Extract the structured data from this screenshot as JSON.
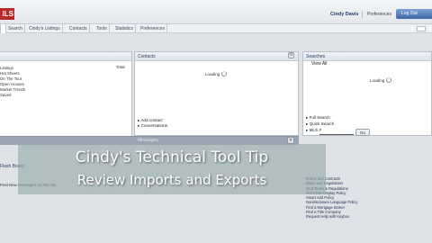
{
  "header": {
    "logo_text": "ILS",
    "user_name": "Cindy Davis",
    "preferences_link": "Preferences",
    "logout_label": "Log Out"
  },
  "tabs": [
    {
      "label": "Home",
      "active": true
    },
    {
      "label": "Search"
    },
    {
      "label": "Cindy's Listings"
    },
    {
      "label": "Contacts"
    },
    {
      "label": "Tools"
    },
    {
      "label": "Statistics"
    },
    {
      "label": "Preferences"
    }
  ],
  "left_panel": {
    "total_label": "Total",
    "items": [
      "Listings",
      "Hot Sheets",
      "On The Tour",
      "Open Houses",
      "Market Trends",
      "",
      "",
      "",
      "",
      "Saved"
    ]
  },
  "contacts": {
    "title": "Contacts",
    "loading": "Loading",
    "actions": [
      "Add contact",
      "Conversations"
    ]
  },
  "searches": {
    "title": "Searches",
    "view_all": "View All",
    "loading": "Loading",
    "links": [
      "Full Search",
      "Quick Search",
      "MLS #"
    ],
    "go_label": "Go"
  },
  "lower_panel": {
    "title": "Messages",
    "left_title": "Flash Board",
    "left_sub": "Post New   Messages on this site"
  },
  "overlay": {
    "line1": "Cindy's Technical Tool Tip",
    "line2": "Review Imports and Exports"
  },
  "links_list": [
    "Forms and Contracts",
    "Rules and Regulations",
    "MLS Rules & Regulations",
    "IDX/VOW Display Policy",
    "Smart Add Policy",
    "Nondisclosure Language Policy",
    "",
    "Find a Mortgage Broker",
    "Find a Title Company",
    "Request Help with Keybox"
  ]
}
